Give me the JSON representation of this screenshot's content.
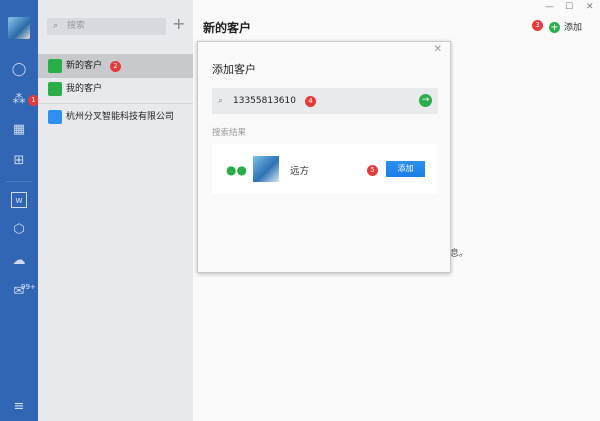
{
  "rail": {
    "items": [
      "chat-icon",
      "org-icon",
      "calendar-icon",
      "apps-icon",
      "word-icon",
      "drive-icon",
      "cloud-phone-icon",
      "mail-icon",
      "menu-icon"
    ],
    "org_badge": "1",
    "mail_badge": "99+"
  },
  "list": {
    "search_placeholder": "搜索",
    "items": [
      {
        "label": "新的客户",
        "badge": "2"
      },
      {
        "label": "我的客户"
      },
      {
        "label": "杭州分叉智能科技有限公司"
      }
    ]
  },
  "main": {
    "title": "新的客户",
    "add_label": "添加",
    "step3": "3",
    "partial_text": "息。"
  },
  "dialog": {
    "title": "添加客户",
    "query": "13355813610",
    "step4": "4",
    "results_label": "搜索结果",
    "result": {
      "name": "远方",
      "step5": "5",
      "add_label": "添加"
    }
  },
  "colors": {
    "rail": "#3166b5",
    "green": "#2aae4a",
    "blue": "#1a7de8",
    "badge": "#e8393a"
  }
}
